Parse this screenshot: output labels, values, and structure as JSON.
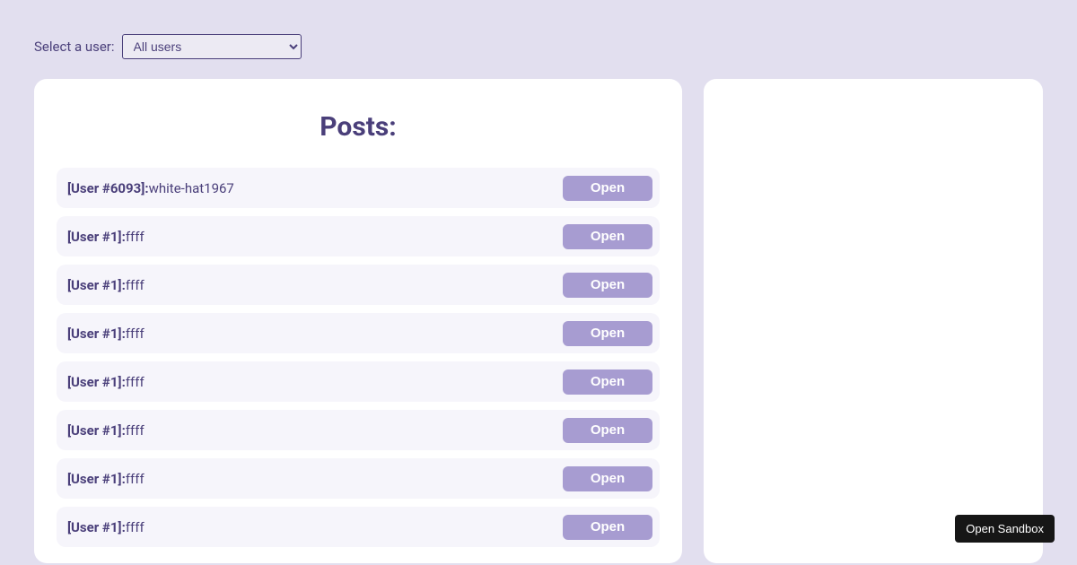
{
  "controls": {
    "select_label": "Select a user:",
    "selected_option": "All users"
  },
  "posts_panel": {
    "title": "Posts:",
    "open_label": "Open",
    "items": [
      {
        "user_prefix": "[User #6093]:",
        "title": "white-hat1967"
      },
      {
        "user_prefix": "[User #1]:",
        "title": "ffff"
      },
      {
        "user_prefix": "[User #1]:",
        "title": "ffff"
      },
      {
        "user_prefix": "[User #1]:",
        "title": "ffff"
      },
      {
        "user_prefix": "[User #1]:",
        "title": "ffff"
      },
      {
        "user_prefix": "[User #1]:",
        "title": "ffff"
      },
      {
        "user_prefix": "[User #1]:",
        "title": "ffff"
      },
      {
        "user_prefix": "[User #1]:",
        "title": "ffff"
      }
    ]
  },
  "sandbox": {
    "open_label": "Open Sandbox"
  }
}
